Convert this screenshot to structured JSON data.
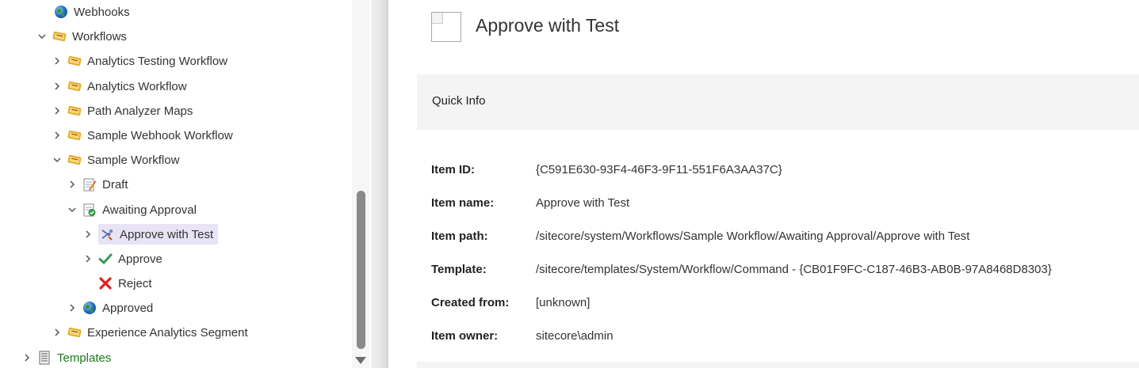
{
  "tree": {
    "nodes": [
      {
        "label": "Webhooks",
        "icon": "globe-icon",
        "chevron": "none"
      },
      {
        "label": "Workflows",
        "icon": "workflow-icon",
        "chevron": "down"
      },
      {
        "label": "Analytics Testing Workflow",
        "icon": "workflow-icon",
        "chevron": "right"
      },
      {
        "label": "Analytics Workflow",
        "icon": "workflow-icon",
        "chevron": "right"
      },
      {
        "label": "Path Analyzer Maps",
        "icon": "workflow-icon",
        "chevron": "right"
      },
      {
        "label": "Sample Webhook Workflow",
        "icon": "workflow-icon",
        "chevron": "right"
      },
      {
        "label": "Sample Workflow",
        "icon": "workflow-icon",
        "chevron": "down"
      },
      {
        "label": "Draft",
        "icon": "draft-icon",
        "chevron": "right"
      },
      {
        "label": "Awaiting Approval",
        "icon": "awaiting-icon",
        "chevron": "down"
      },
      {
        "label": "Approve with Test",
        "icon": "command-icon",
        "chevron": "right",
        "selected": true
      },
      {
        "label": "Approve",
        "icon": "checkmark-icon",
        "chevron": "right"
      },
      {
        "label": "Reject",
        "icon": "reject-icon",
        "chevron": "none"
      },
      {
        "label": "Approved",
        "icon": "globe-icon",
        "chevron": "right"
      },
      {
        "label": "Experience Analytics Segment",
        "icon": "workflow-icon",
        "chevron": "right"
      },
      {
        "label": "Templates",
        "icon": "templates-icon",
        "chevron": "right",
        "green": true
      }
    ]
  },
  "content": {
    "title": "Approve with Test",
    "quick_info": "Quick Info",
    "rows": [
      {
        "label": "Item ID:",
        "value": "{C591E630-93F4-46F3-9F11-551F6A3AA37C}"
      },
      {
        "label": "Item name:",
        "value": "Approve with Test"
      },
      {
        "label": "Item path:",
        "value": "/sitecore/system/Workflows/Sample Workflow/Awaiting Approval/Approve with Test"
      },
      {
        "label": "Template:",
        "value": "/sitecore/templates/System/Workflow/Command - {CB01F9FC-C187-46B3-AB0B-97A8468D8303}"
      },
      {
        "label": "Created from:",
        "value": "[unknown]"
      },
      {
        "label": "Item owner:",
        "value": "sitecore\\admin"
      }
    ]
  },
  "colors": {
    "selected_bg": "#e8e4f5",
    "templates_green": "#1a7a1a",
    "panel_gray": "#f4f4f4"
  }
}
